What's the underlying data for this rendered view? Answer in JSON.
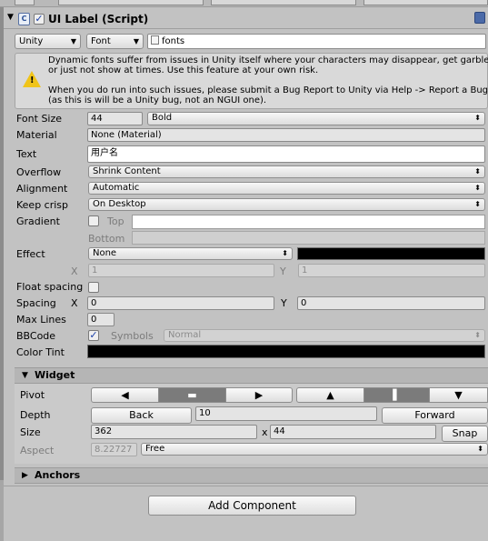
{
  "component": {
    "title": "UI Label (Script)",
    "enabled": true
  },
  "font_row": {
    "font_source": "Unity",
    "font_type": "Font",
    "font_value": "fonts"
  },
  "warning": {
    "line1": "Dynamic fonts suffer from issues in Unity itself where your characters may disappear, get garbled,",
    "line2": "or just not show at times. Use this feature at your own risk.",
    "line3": "When you do run into such issues, please submit a Bug Report to Unity via Help -> Report a Bug",
    "line4": "(as this is will be a Unity bug, not an NGUI one)."
  },
  "props": {
    "font_size_label": "Font Size",
    "font_size": "44",
    "font_style": "Bold",
    "material_label": "Material",
    "material": "None (Material)",
    "text_label": "Text",
    "text": "用户名",
    "overflow_label": "Overflow",
    "overflow": "Shrink Content",
    "alignment_label": "Alignment",
    "alignment": "Automatic",
    "keep_crisp_label": "Keep crisp",
    "keep_crisp": "On Desktop",
    "gradient_label": "Gradient",
    "gradient_top_label": "Top",
    "gradient_bottom_label": "Bottom",
    "effect_label": "Effect",
    "effect": "None",
    "effect_x_label": "X",
    "effect_x": "1",
    "effect_y_label": "Y",
    "effect_y": "1",
    "float_spacing_label": "Float spacing",
    "spacing_label": "Spacing",
    "spacing_x_label": "X",
    "spacing_x": "0",
    "spacing_y_label": "Y",
    "spacing_y": "0",
    "max_lines_label": "Max Lines",
    "max_lines": "0",
    "bbcode_label": "BBCode",
    "symbols_label": "Symbols",
    "symbols": "Normal",
    "color_tint_label": "Color Tint"
  },
  "widget": {
    "header": "Widget",
    "pivot_label": "Pivot",
    "depth_label": "Depth",
    "back_label": "Back",
    "depth": "10",
    "forward_label": "Forward",
    "size_label": "Size",
    "width": "362",
    "x_label": "x",
    "height": "44",
    "snap_label": "Snap",
    "aspect_label": "Aspect",
    "aspect": "8.22727",
    "aspect_mode": "Free"
  },
  "anchors": {
    "header": "Anchors"
  },
  "add_component_label": "Add Component",
  "colors": {
    "panel": "#c2c2c2",
    "color_tint": "#000000",
    "effect_color": "#000000",
    "gradient_top": "#ffffff"
  },
  "icons": [
    "settings-icon",
    "script-icon",
    "warning-icon",
    "arrow-left-icon",
    "arrow-right-icon",
    "arrow-up-icon",
    "arrow-down-icon"
  ]
}
